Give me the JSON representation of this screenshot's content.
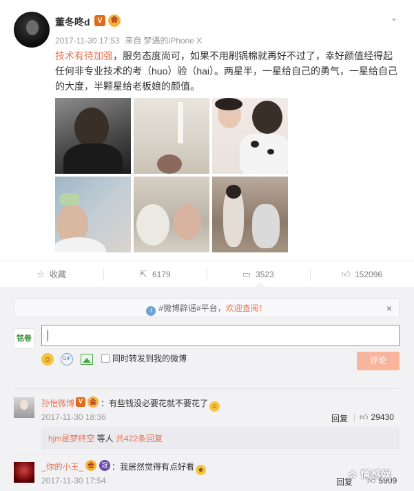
{
  "post": {
    "username": "董冬咚d",
    "badge_v": "V",
    "badge_vip": "会",
    "timestamp": "2017-11-30 17:53",
    "source": "来自 梦遇的iPhone X",
    "content_link": "技术有待加强",
    "content_text": "，服务态度尚可，如果不用刷锅棉就再好不过了，幸好颜值经得起任何非专业技术的考（huo）验（hai）。两星半，一星给自己的勇气，一星给自己的大度，半颗星给老板娘的颜值。",
    "photos": [
      {
        "icon": "photo-back-of-head"
      },
      {
        "icon": "photo-ceiling"
      },
      {
        "icon": "photo-selfie"
      },
      {
        "icon": "photo-hair-washing"
      },
      {
        "icon": "photo-lying-selfie"
      },
      {
        "icon": "photo-salon-mirror"
      }
    ]
  },
  "actions": {
    "favorite_label": "收藏",
    "repost_count": "6179",
    "comment_count": "3523",
    "like_count": "152096"
  },
  "notice": {
    "prefix": "#微博辟谣#平台，",
    "highlight": "欢迎查阅！"
  },
  "composer": {
    "avatar_text": "铭卷",
    "input_value": "",
    "repost_label": "同时转发到我的微博",
    "submit_label": "评论"
  },
  "comments": [
    {
      "name": "孙怡微博",
      "badge_v": "V",
      "badge_vip": "会",
      "text": "：有些钱没必要花就不要花了",
      "emoji": "smile-emoji",
      "time": "2017-11-30 18:36",
      "reply_label": "回复",
      "likes": "29430",
      "sub_link": "hjm是梦终空",
      "sub_mid": " 等人 ",
      "sub_count": "共422条回复"
    },
    {
      "name": "_你的小王_",
      "badge_vip": "会",
      "badge_crown": "冠",
      "text": "：我居然觉得有点好看",
      "emoji": "grin-emoji",
      "time": "2017-11-30 17:54",
      "reply_label": "回复",
      "likes": "5909"
    }
  ],
  "watermark": "情感娱",
  "colors": {
    "accent": "#eb7350",
    "muted": "#999999",
    "panel_bg": "#f2f2f5"
  }
}
